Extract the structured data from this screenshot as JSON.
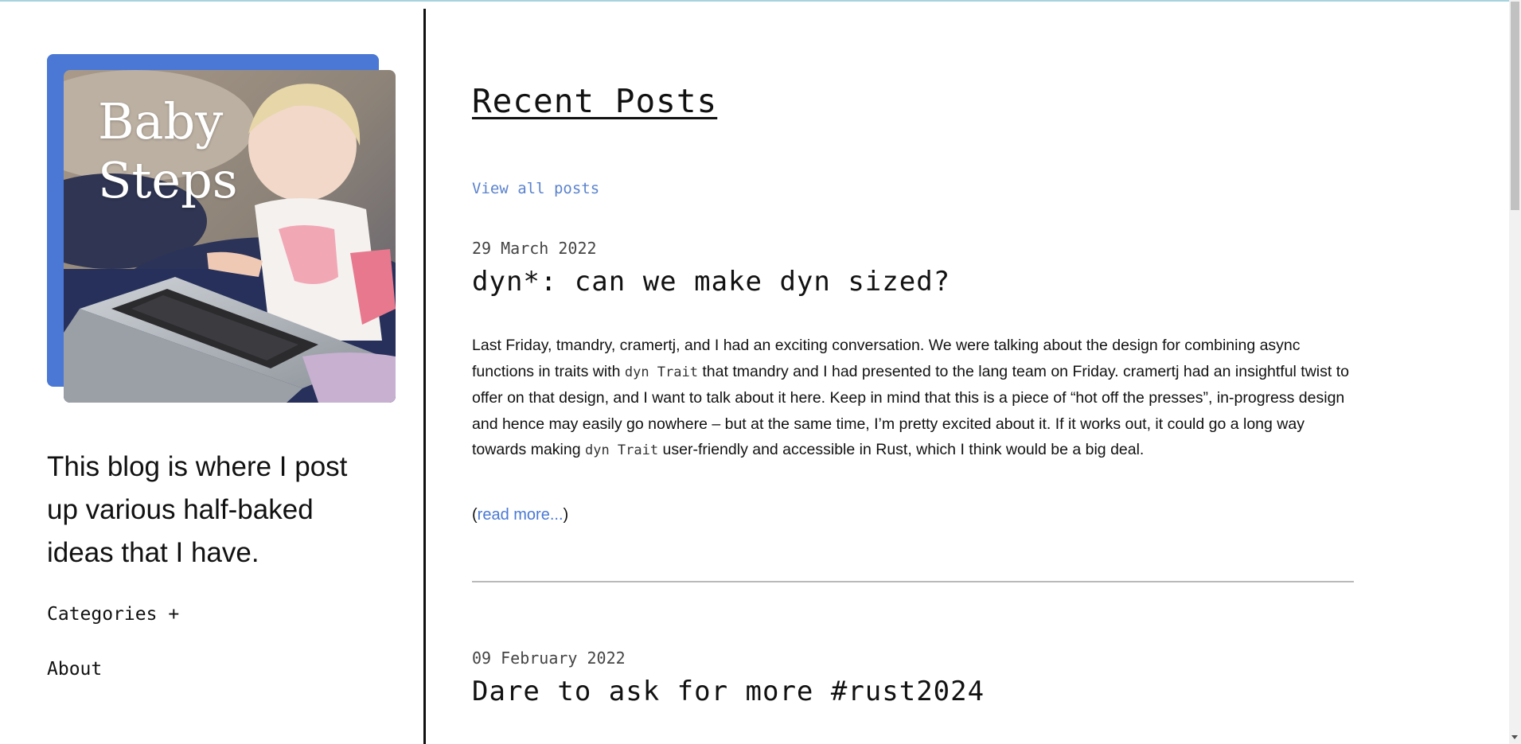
{
  "sidebar": {
    "logo": {
      "line1": "Baby",
      "line2": "Steps",
      "accent": "#4a78d4"
    },
    "blurb": "This blog is where I post up various half-baked ideas that I have.",
    "nav": {
      "categories": "Categories +",
      "about": "About"
    }
  },
  "main": {
    "heading": "Recent Posts",
    "view_all": "View all posts",
    "posts": [
      {
        "date": "29 March 2022",
        "title": "dyn*: can we make dyn sized?",
        "excerpt": {
          "p1": "Last Friday, tmandry, cramertj, and I had an exciting conversation. We were talking about the design for combining async functions in traits with ",
          "code1": "dyn Trait",
          "p2": " that tmandry and I had presented to the lang team on Friday. cramertj had an insightful twist to offer on that design, and I want to talk about it here. Keep in mind that this is a piece of “hot off the presses”, in-progress design and hence may easily go nowhere – but at the same time, I’m pretty excited about it. If it works out, it could go a long way towards making ",
          "code2": "dyn Trait",
          "p3": " user-friendly and accessible in Rust, which I think would be a big deal."
        },
        "read_more": {
          "open": "(",
          "link": "read more...",
          "close": ")"
        }
      },
      {
        "date": "09 February 2022",
        "title": "Dare to ask for more #rust2024"
      }
    ]
  },
  "colors": {
    "link": "#4a78d4",
    "top_line": "#a9d3dc"
  }
}
